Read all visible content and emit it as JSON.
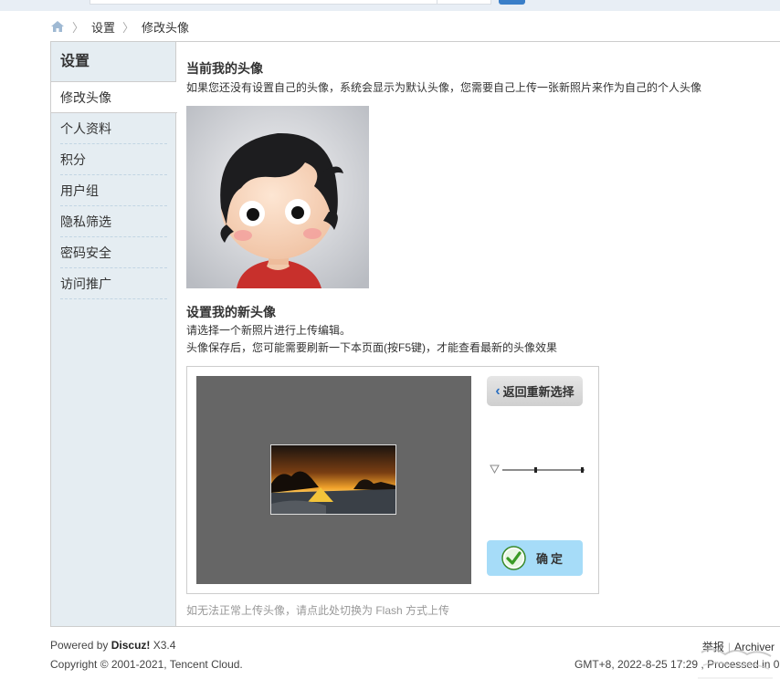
{
  "breadcrumb": {
    "home_icon": "home-icon",
    "items": [
      "设置",
      "修改头像"
    ]
  },
  "sidebar": {
    "title": "设置",
    "items": [
      "修改头像",
      "个人资料",
      "积分",
      "用户组",
      "隐私筛选",
      "密码安全",
      "访问推广"
    ],
    "active_index": 0
  },
  "current_avatar": {
    "heading": "当前我的头像",
    "description": "如果您还没有设置自己的头像，系统会显示为默认头像，您需要自己上传一张新照片来作为自己的个人头像"
  },
  "new_avatar": {
    "heading": "设置我的新头像",
    "line1": "请选择一个新照片进行上传编辑。",
    "line2": "头像保存后，您可能需要刷新一下本页面(按F5键)，才能查看最新的头像效果",
    "back_button": "返回重新选择",
    "confirm_button": "确定",
    "flash_link": "如无法正常上传头像，请点此处切换为 Flash 方式上传"
  },
  "footer": {
    "powered_prefix": "Powered by",
    "powered_brand": "Discuz!",
    "powered_version": "X3.4",
    "copyright": "Copyright © 2001-2021, Tencent Cloud.",
    "report": "举报",
    "archiver": "Archiver",
    "time": "GMT+8, 2022-8-25 17:29 , Processed in 0"
  },
  "colors": {
    "accent": "#3a7ec8",
    "sidebar_bg": "#e5edf2",
    "confirm_bg": "#a6dcf8",
    "canvas_bg": "#666666"
  }
}
